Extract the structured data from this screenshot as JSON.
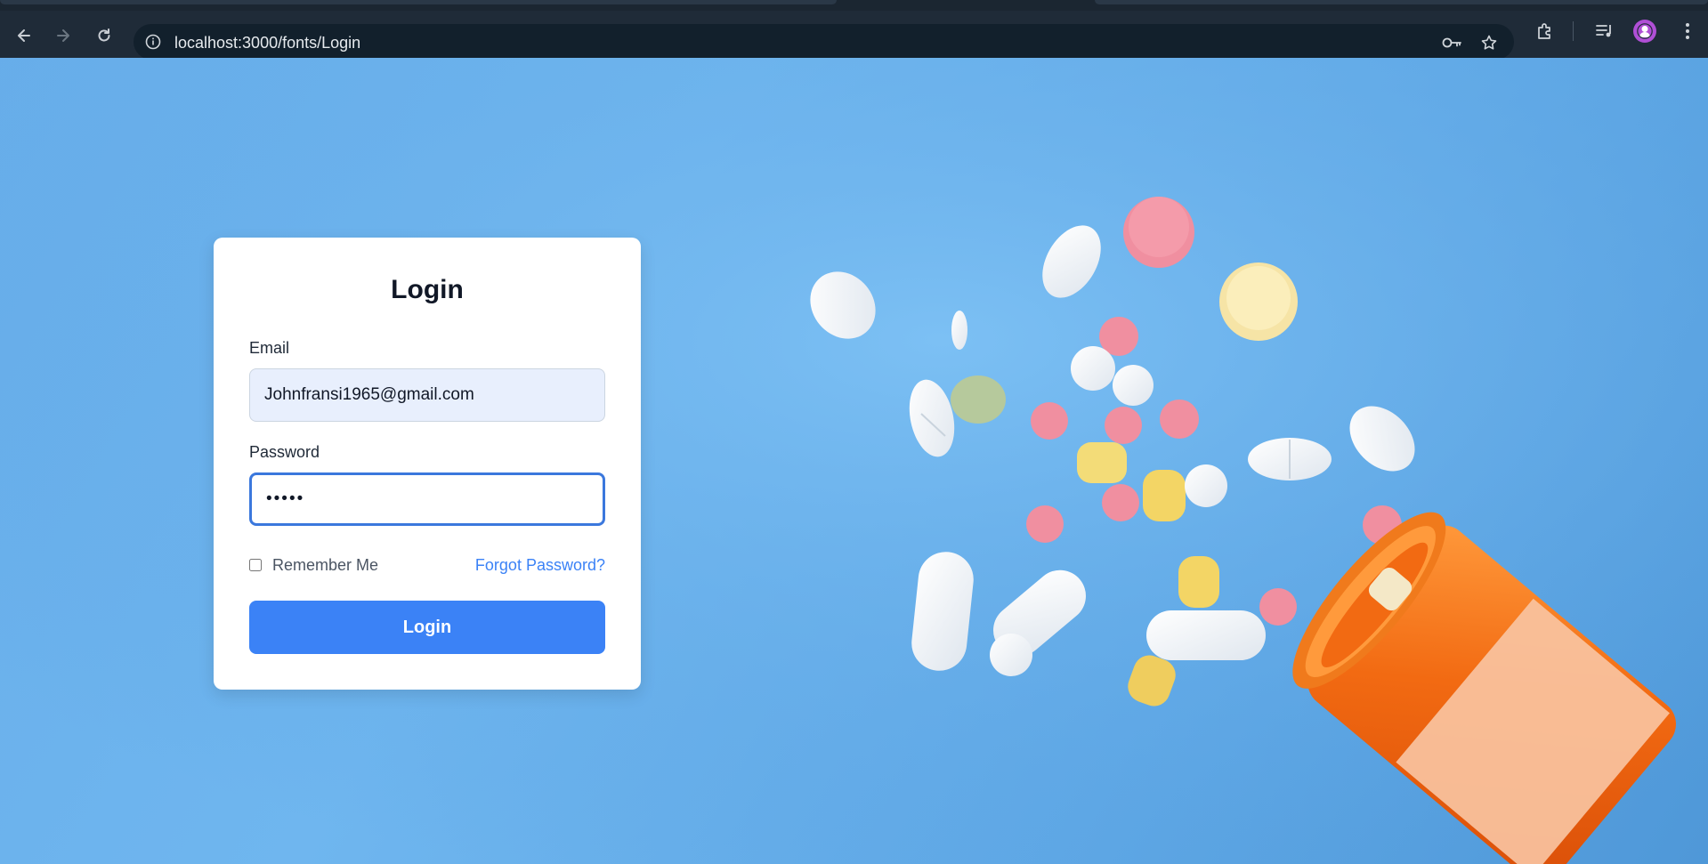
{
  "browser": {
    "url": "localhost:3000/fonts/Login",
    "icons": [
      "back-icon",
      "forward-icon",
      "reload-icon",
      "site-info-icon",
      "password-key-icon",
      "bookmark-star-icon",
      "extensions-icon",
      "media-controls-icon",
      "profile-avatar",
      "menu-dots-icon"
    ]
  },
  "login": {
    "title": "Login",
    "email_label": "Email",
    "email_value": "Johnfransi1965@gmail.com",
    "password_label": "Password",
    "password_value": "•••••",
    "remember_label": "Remember Me",
    "remember_checked": false,
    "forgot_label": "Forgot Password?",
    "submit_label": "Login"
  },
  "colors": {
    "accent": "#3b82f6",
    "background": "#6fb6ef",
    "bottle": "#f26a12"
  }
}
